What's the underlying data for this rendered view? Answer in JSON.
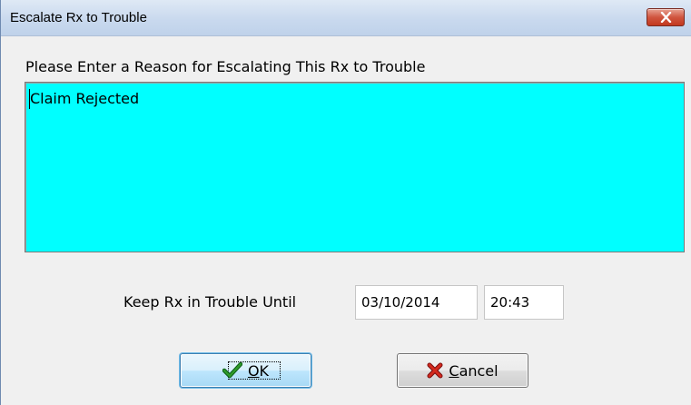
{
  "window": {
    "title": "Escalate Rx to Trouble",
    "close_icon": "close-x-icon"
  },
  "reason": {
    "prompt": "Please Enter a Reason for Escalating This Rx to Trouble",
    "value": "Claim Rejected",
    "background": "#00ffff"
  },
  "trouble_until": {
    "label": "Keep Rx in Trouble Until",
    "date": "03/10/2014",
    "time": "20:43"
  },
  "buttons": {
    "ok": {
      "mnemonic": "O",
      "rest": "K",
      "icon": "checkmark-icon"
    },
    "cancel": {
      "mnemonic": "C",
      "rest": "ancel",
      "icon": "red-x-icon"
    }
  }
}
